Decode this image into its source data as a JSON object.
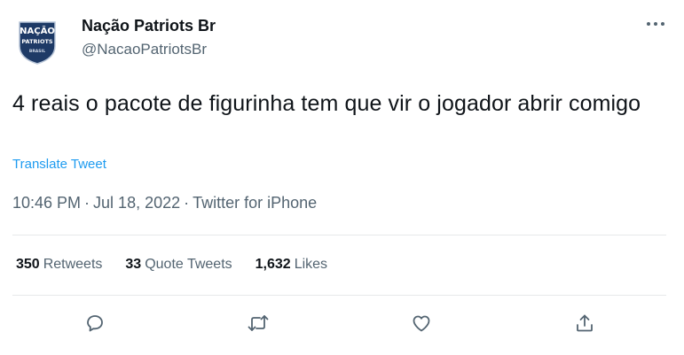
{
  "author": {
    "display_name": "Nação Patriots Br",
    "handle": "@NacaoPatriotsBr",
    "avatar_text": [
      "NAÇÃO",
      "PATRIOTS",
      "BRASIL"
    ]
  },
  "tweet": {
    "text": "4 reais o pacote de figurinha tem que vir o jogador abrir comigo",
    "translate_label": "Translate Tweet",
    "time": "10:46 PM",
    "date": "Jul 18, 2022",
    "source": "Twitter for iPhone",
    "separator": "·"
  },
  "stats": [
    {
      "count": "350",
      "label": "Retweets"
    },
    {
      "count": "33",
      "label": "Quote Tweets"
    },
    {
      "count": "1,632",
      "label": "Likes"
    }
  ],
  "actions": [
    "reply-icon",
    "retweet-icon",
    "like-icon",
    "share-icon"
  ],
  "colors": {
    "link": "#1d9bf0",
    "secondary_text": "#536471",
    "primary_text": "#0f1419",
    "divider": "#e7e9ea",
    "avatar_navy": "#1e3a66"
  }
}
